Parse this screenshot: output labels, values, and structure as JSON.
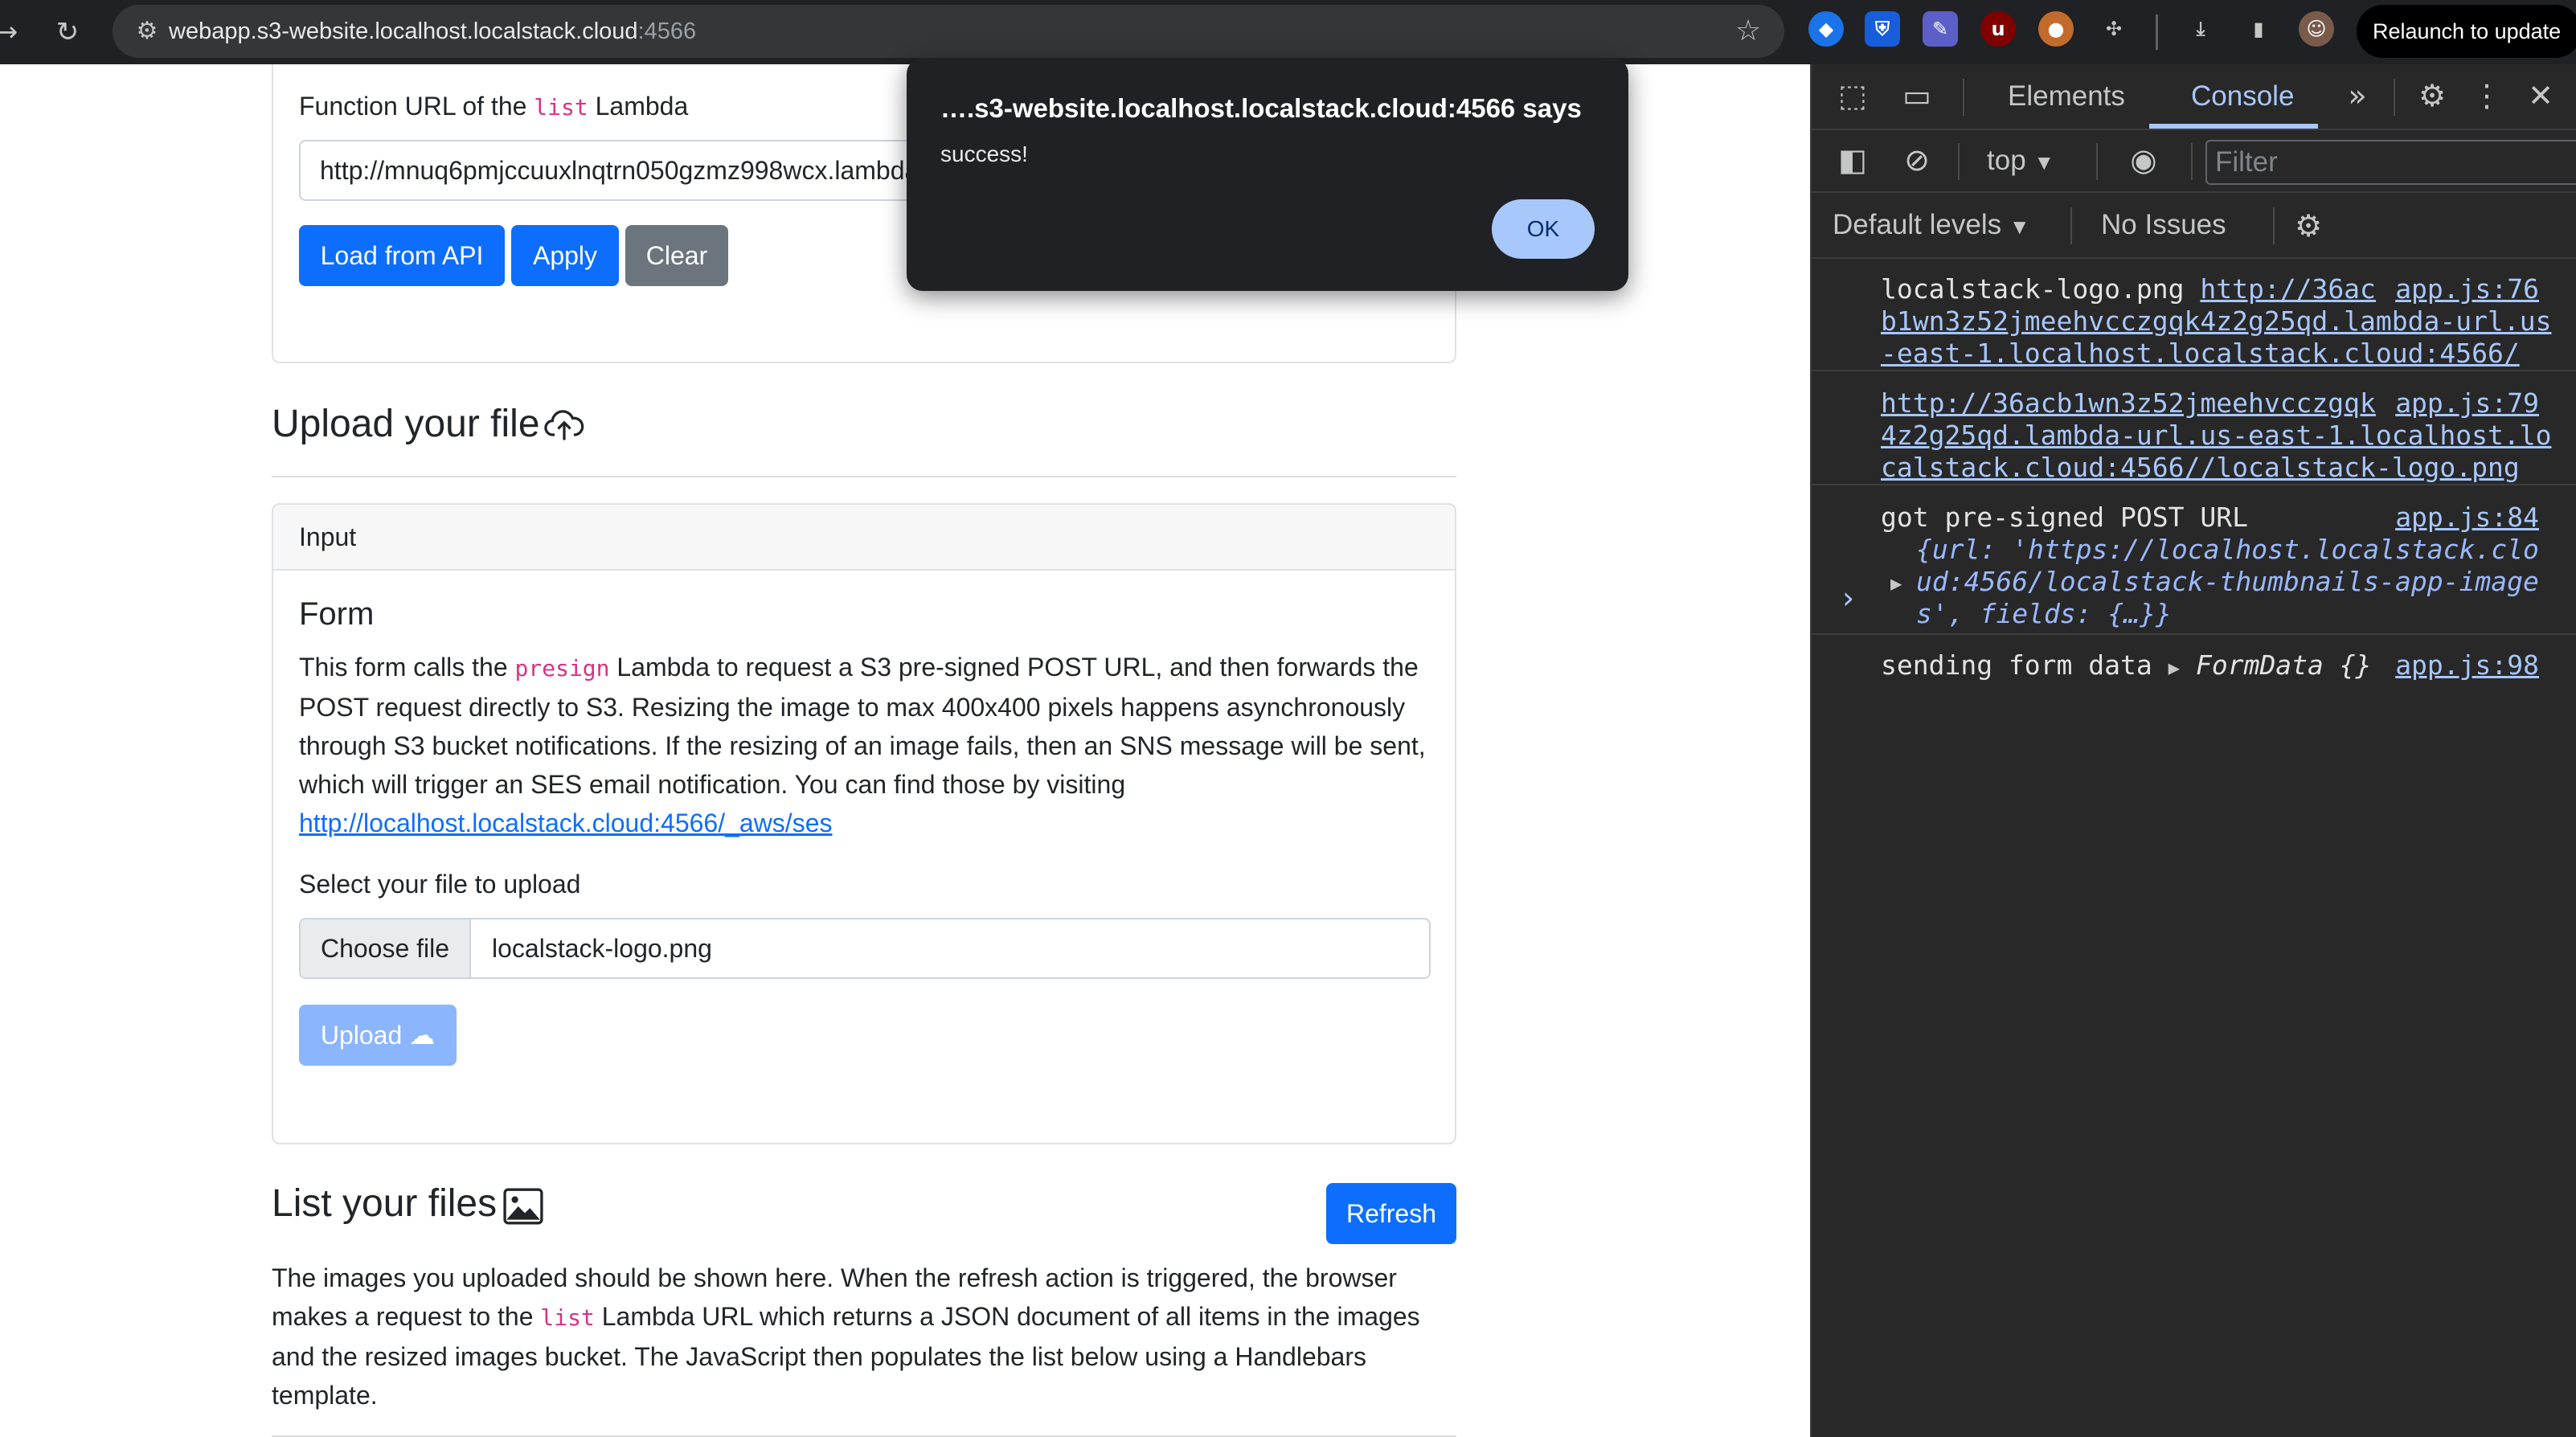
{
  "browser": {
    "url_host": "webapp.s3-website.localhost.localstack.cloud",
    "url_port": ":4566",
    "relaunch_label": "Relaunch to update"
  },
  "lambda_section": {
    "label_prefix": "Function URL of the",
    "label_code": "list",
    "label_suffix": "Lambda",
    "url_value": "http://mnuq6pmjccuuxlnqtrn050gzmz998wcx.lambda-url.us-east-1.localhost.localstack.cloud:4566/",
    "buttons": {
      "load": "Load from API",
      "apply": "Apply",
      "clear": "Clear"
    }
  },
  "upload_section": {
    "heading": "Upload your file",
    "card_header": "Input",
    "form_title": "Form",
    "desc_1": "This form calls the",
    "desc_code": "presign",
    "desc_2": "Lambda to request a S3 pre-signed POST URL, and then forwards the POST request directly to S3. Resizing the image to max 400x400 pixels happens asynchronously through S3 bucket notifications. If the resizing of an image fails, then an SNS message will be sent, which will trigger an SES email notification. You can find those by visiting",
    "desc_link": "http://localhost.localstack.cloud:4566/_aws/ses",
    "file_label": "Select your file to upload",
    "choose_file": "Choose file",
    "file_name": "localstack-logo.png",
    "upload_button": "Upload"
  },
  "list_section": {
    "heading": "List your files",
    "refresh_button": "Refresh",
    "desc_1": "The images you uploaded should be shown here. When the refresh action is triggered, the browser makes a request to the",
    "desc_code": "list",
    "desc_2": "Lambda URL which returns a JSON document of all items in the images and the resized images bucket. The JavaScript then populates the list below using a Handlebars template."
  },
  "dialog": {
    "title": "….s3-website.localhost.localstack.cloud:4566 says",
    "message": "success!",
    "ok": "OK"
  },
  "devtools": {
    "tabs": {
      "elements": "Elements",
      "console": "Console"
    },
    "context": "top",
    "filter_placeholder": "Filter",
    "levels": "Default levels",
    "issues": "No Issues",
    "logs": {
      "e1": {
        "text": "localstack-logo.png",
        "link_1": "http://36ac",
        "link_2": "b1wn3z52jmeehvcczgqk4z2g25qd.lambda-url.us",
        "link_3": "-east-1.localhost.localstack.cloud:4566/",
        "src": "app.js:76"
      },
      "e2": {
        "link_1": "http://36acb1wn3z52jmeehvcczgqk",
        "link_2": "4z2g25qd.lambda-url.us-east-1.localhost.lo",
        "link_3": "calstack.cloud:4566//localstack-logo.png",
        "src": "app.js:79"
      },
      "e3": {
        "text": "got pre-signed POST URL",
        "line_2": "{url: 'https://localhost.localstack.clo",
        "line_3": "ud:4566/localstack-thumbnails-app-image",
        "line_4": "s', fields: {…}}",
        "src": "app.js:84"
      },
      "e4": {
        "text": "sending form data",
        "obj": "FormData {}",
        "src": "app.js:98"
      }
    }
  },
  "icons": {
    "back": "back-arrow-icon",
    "reload": "reload-icon",
    "site_settings": "tune-icon",
    "bookmark": "star-icon",
    "upload_cloud": "cloud-upload-icon",
    "images": "image-icon",
    "inspect": "inspect-element-icon",
    "device": "device-toolbar-icon",
    "settings": "gear-icon"
  },
  "colors": {
    "primary": "#0d6efd",
    "secondary": "#6c757d",
    "code_pink": "#d63384",
    "devtools_accent": "#a8c7fa"
  }
}
